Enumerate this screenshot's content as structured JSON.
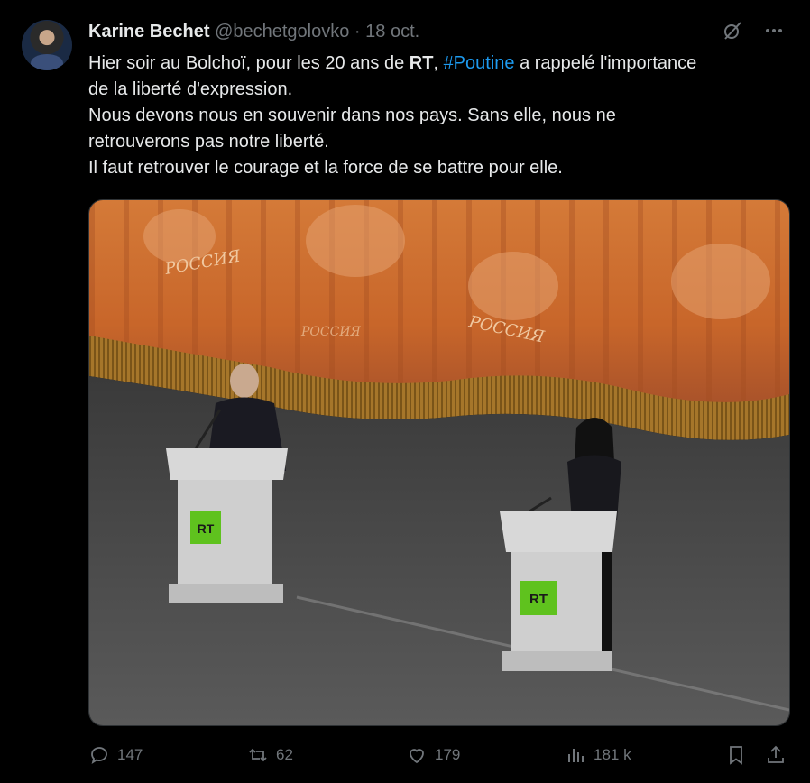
{
  "author": {
    "name": "Karine Bechet",
    "handle": "@bechetgolovko",
    "separator": "·",
    "date": "18 oct."
  },
  "header_icons": [
    "grok-icon",
    "more-icon"
  ],
  "tweet": {
    "line1_pre": "Hier soir au Bolchoï, pour les 20 ans de ",
    "line1_bold": "RT",
    "line1_mid": ", ",
    "line1_link": "#Poutine",
    "line1_post": " a rappelé l'importance",
    "line2": "de la liberté d'expression.",
    "line3": "Nous devons nous en souvenir dans nos pays. Sans elle, nous ne",
    "line4": "retrouverons pas notre liberté.",
    "line5": "Il faut retrouver le courage et la force de se battre pour elle."
  },
  "media": {
    "curtain_text_1": "РОССИЯ",
    "curtain_text_2": "РОССИЯ",
    "curtain_text_3": "РОССИЯ",
    "podium_logo_left": "RT",
    "podium_logo_right": "RT",
    "colors": {
      "curtain": "#c8662a",
      "fringe": "#b8862a",
      "stage": "#4a4a4a",
      "logo": "#5fc21e"
    }
  },
  "actions": {
    "replies": "147",
    "retweets": "62",
    "likes": "179",
    "views": "181 k"
  },
  "action_icons": [
    "reply-icon",
    "retweet-icon",
    "like-icon",
    "views-icon",
    "bookmark-icon",
    "share-icon"
  ]
}
